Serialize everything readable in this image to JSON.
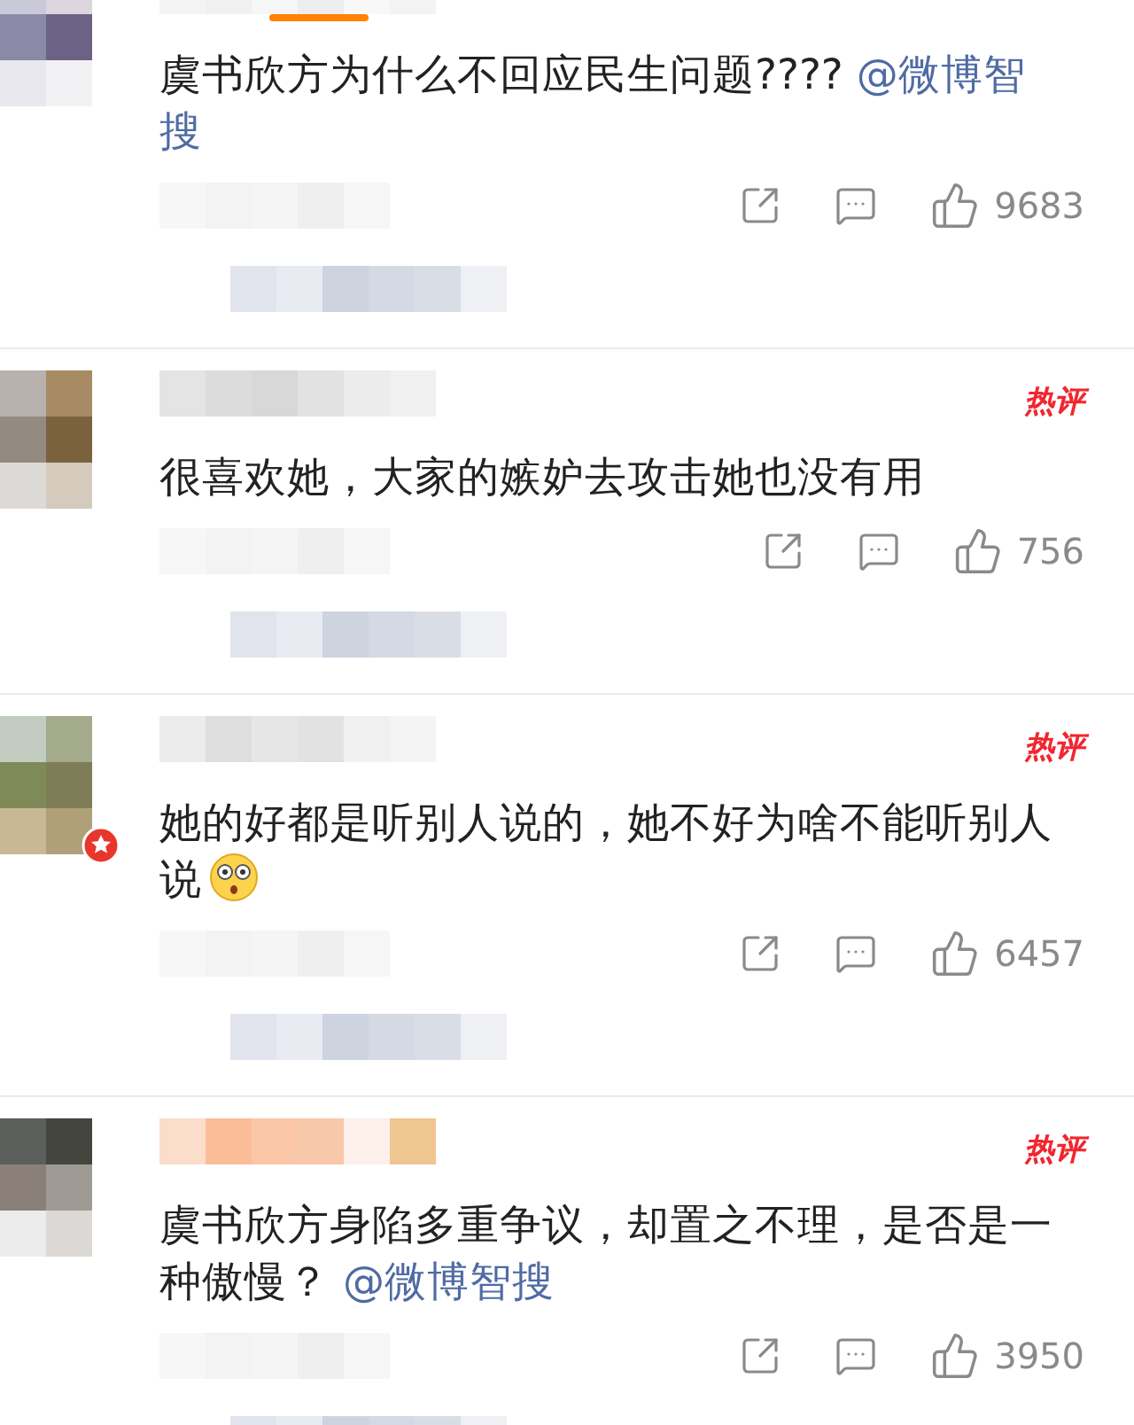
{
  "comments": [
    {
      "hot": false,
      "verified": false,
      "text": "虞书欣方为什么不回应民生问题???? ",
      "mention": "@微博智搜",
      "has_emoji": false,
      "likes": "9683"
    },
    {
      "hot": true,
      "badge": "热评",
      "verified": false,
      "text": "很喜欢她，大家的嫉妒去攻击她也没有用",
      "has_emoji": false,
      "likes": "756"
    },
    {
      "hot": true,
      "badge": "热评",
      "verified": true,
      "text": "她的好都是听别人说的，她不好为啥不能听别人说",
      "has_emoji": true,
      "likes": "6457"
    },
    {
      "hot": true,
      "badge": "热评",
      "verified": false,
      "text": "虞书欣方身陷多重争议，却置之不理，是否是一种傲慢？ ",
      "mention": "@微博智搜",
      "has_emoji": false,
      "likes": "3950"
    }
  ]
}
